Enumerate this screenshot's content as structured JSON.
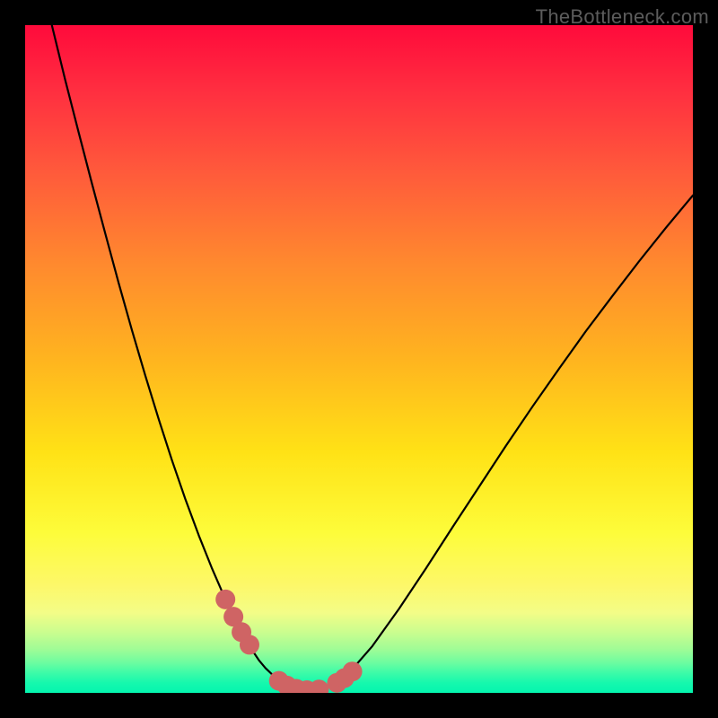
{
  "watermark": "TheBottleneck.com",
  "chart_data": {
    "type": "line",
    "title": "",
    "xlabel": "",
    "ylabel": "",
    "xlim": [
      0,
      1
    ],
    "ylim": [
      0,
      1
    ],
    "series": [
      {
        "name": "bottleneck-curve",
        "x": [
          0.04,
          0.06,
          0.08,
          0.1,
          0.12,
          0.14,
          0.16,
          0.18,
          0.2,
          0.22,
          0.24,
          0.26,
          0.28,
          0.3,
          0.32,
          0.33,
          0.34,
          0.35,
          0.36,
          0.38,
          0.4,
          0.42,
          0.44,
          0.46,
          0.48,
          0.52,
          0.56,
          0.6,
          0.64,
          0.68,
          0.72,
          0.76,
          0.8,
          0.84,
          0.88,
          0.92,
          0.96,
          1.0
        ],
        "y": [
          1.0,
          0.918,
          0.84,
          0.763,
          0.688,
          0.614,
          0.543,
          0.475,
          0.41,
          0.348,
          0.29,
          0.236,
          0.186,
          0.14,
          0.098,
          0.08,
          0.064,
          0.049,
          0.037,
          0.018,
          0.008,
          0.004,
          0.005,
          0.011,
          0.024,
          0.07,
          0.126,
          0.186,
          0.248,
          0.309,
          0.37,
          0.429,
          0.486,
          0.542,
          0.595,
          0.647,
          0.697,
          0.745
        ]
      },
      {
        "name": "highlight-markers",
        "x": [
          0.3,
          0.312,
          0.324,
          0.336,
          0.38,
          0.392,
          0.406,
          0.422,
          0.44,
          0.467,
          0.478,
          0.49
        ],
        "y": [
          0.14,
          0.114,
          0.091,
          0.072,
          0.018,
          0.011,
          0.006,
          0.004,
          0.005,
          0.015,
          0.022,
          0.032
        ]
      }
    ],
    "colors": {
      "curve": "#000000",
      "markers": "#cf6464",
      "gradient_top": "#ff0a3b",
      "gradient_bottom": "#04f5af"
    }
  }
}
